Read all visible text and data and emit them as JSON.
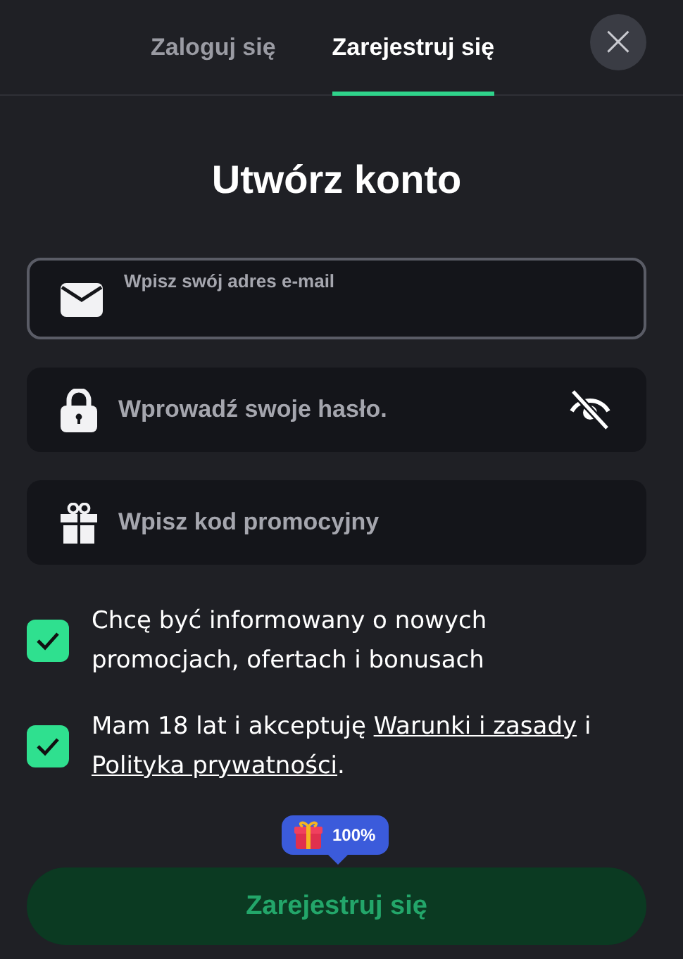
{
  "tabs": [
    {
      "label": "Zaloguj się",
      "selected": false
    },
    {
      "label": "Zarejestruj się",
      "selected": true
    }
  ],
  "close": {
    "label": "×"
  },
  "title": "Utwórz konto",
  "fields": [
    {
      "kind": "email",
      "placeholder": "Wpisz swój adres e-mail",
      "focused": true
    },
    {
      "kind": "password",
      "placeholder": "Wprowadź swoje hasło.",
      "focused": false,
      "password_visible": false
    },
    {
      "kind": "promo",
      "placeholder": "Wpisz kod promocyjny",
      "focused": false
    }
  ],
  "consents": [
    {
      "checked": true,
      "parts": [
        {
          "kind": "text",
          "text": "Chcę być informowany o nowych promocjach, ofertach i bonusach"
        }
      ]
    },
    {
      "checked": true,
      "parts": [
        {
          "kind": "text",
          "text": "Mam 18 lat i akceptuję "
        },
        {
          "kind": "link",
          "text": "Warunki i zasady"
        },
        {
          "kind": "text",
          "text": " i "
        },
        {
          "kind": "link",
          "text": "Polityka prywatności"
        },
        {
          "kind": "text",
          "text": "."
        }
      ]
    }
  ],
  "bonus_badge": {
    "text": "100%"
  },
  "submit": {
    "label": "Zarejestruj się",
    "disabled": true
  }
}
